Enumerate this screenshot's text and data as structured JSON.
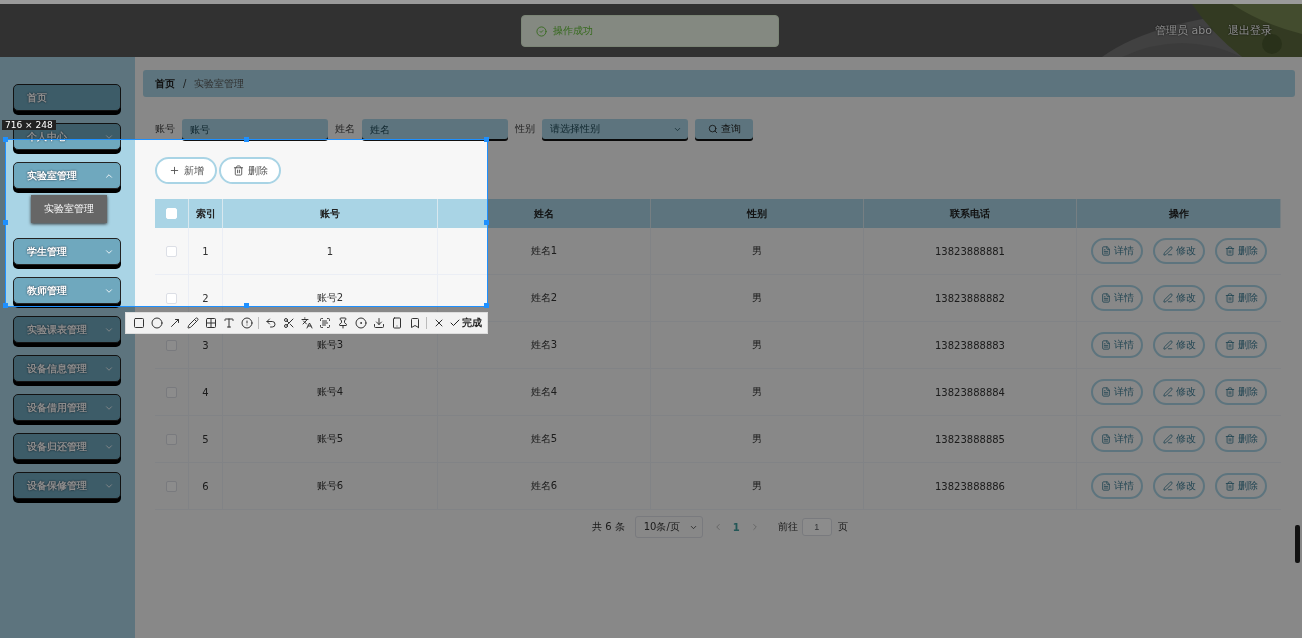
{
  "header": {
    "user": "管理员 abo",
    "logout": "退出登录"
  },
  "toast": {
    "text": "操作成功"
  },
  "sidebar": {
    "items": [
      {
        "label": "首页",
        "kind": "link"
      },
      {
        "label": "个人中心",
        "kind": "menu",
        "expanded": false
      },
      {
        "label": "实验室管理",
        "kind": "menu",
        "expanded": true,
        "children": [
          {
            "label": "实验室管理"
          }
        ]
      },
      {
        "label": "学生管理",
        "kind": "menu",
        "expanded": false
      },
      {
        "label": "教师管理",
        "kind": "menu",
        "expanded": false
      },
      {
        "label": "实验课表管理",
        "kind": "menu",
        "expanded": false
      },
      {
        "label": "设备信息管理",
        "kind": "menu",
        "expanded": false
      },
      {
        "label": "设备借用管理",
        "kind": "menu",
        "expanded": false
      },
      {
        "label": "设备归还管理",
        "kind": "menu",
        "expanded": false
      },
      {
        "label": "设备保修管理",
        "kind": "menu",
        "expanded": false
      }
    ]
  },
  "breadcrumb": {
    "items": [
      "首页",
      "实验室管理"
    ],
    "separator": "/"
  },
  "search": {
    "fields": [
      {
        "label": "账号",
        "placeholder": "账号",
        "kind": "input"
      },
      {
        "label": "姓名",
        "placeholder": "姓名",
        "kind": "input"
      },
      {
        "label": "性别",
        "placeholder": "请选择性别",
        "kind": "select"
      }
    ],
    "button": "查询"
  },
  "actions": [
    {
      "label": "新增",
      "kind": "add"
    },
    {
      "label": "删除",
      "kind": "delete"
    }
  ],
  "table": {
    "all_checked": false,
    "columns": [
      "索引",
      "账号",
      "姓名",
      "性别",
      "联系电话",
      "操作"
    ],
    "rows": [
      {
        "checked": false,
        "cells": [
          "1",
          "1",
          "姓名1",
          "男",
          "13823888881"
        ],
        "actions": [
          {
            "label": "详情",
            "kind": "detail"
          },
          {
            "label": "修改",
            "kind": "edit"
          },
          {
            "label": "删除",
            "kind": "delete"
          }
        ]
      },
      {
        "checked": false,
        "cells": [
          "2",
          "账号2",
          "姓名2",
          "男",
          "13823888882"
        ],
        "actions": [
          {
            "label": "详情",
            "kind": "detail"
          },
          {
            "label": "修改",
            "kind": "edit"
          },
          {
            "label": "删除",
            "kind": "delete"
          }
        ]
      },
      {
        "checked": false,
        "cells": [
          "3",
          "账号3",
          "姓名3",
          "男",
          "13823888883"
        ],
        "actions": [
          {
            "label": "详情",
            "kind": "detail"
          },
          {
            "label": "修改",
            "kind": "edit"
          },
          {
            "label": "删除",
            "kind": "delete"
          }
        ]
      },
      {
        "checked": false,
        "cells": [
          "4",
          "账号4",
          "姓名4",
          "男",
          "13823888884"
        ],
        "actions": [
          {
            "label": "详情",
            "kind": "detail"
          },
          {
            "label": "修改",
            "kind": "edit"
          },
          {
            "label": "删除",
            "kind": "delete"
          }
        ]
      },
      {
        "checked": false,
        "cells": [
          "5",
          "账号5",
          "姓名5",
          "男",
          "13823888885"
        ],
        "actions": [
          {
            "label": "详情",
            "kind": "detail"
          },
          {
            "label": "修改",
            "kind": "edit"
          },
          {
            "label": "删除",
            "kind": "delete"
          }
        ]
      },
      {
        "checked": false,
        "cells": [
          "6",
          "账号6",
          "姓名6",
          "男",
          "13823888886"
        ],
        "actions": [
          {
            "label": "详情",
            "kind": "detail"
          },
          {
            "label": "修改",
            "kind": "edit"
          },
          {
            "label": "删除",
            "kind": "delete"
          }
        ]
      }
    ]
  },
  "pagination": {
    "total": "共 6 条",
    "page_size": "10条/页",
    "pages": [
      {
        "label": "1",
        "selected": true
      }
    ],
    "goto_label": "前往",
    "goto_value": "1",
    "goto_suffix": "页"
  },
  "capture": {
    "size_label": "716 × 248",
    "done_label": "完成"
  }
}
